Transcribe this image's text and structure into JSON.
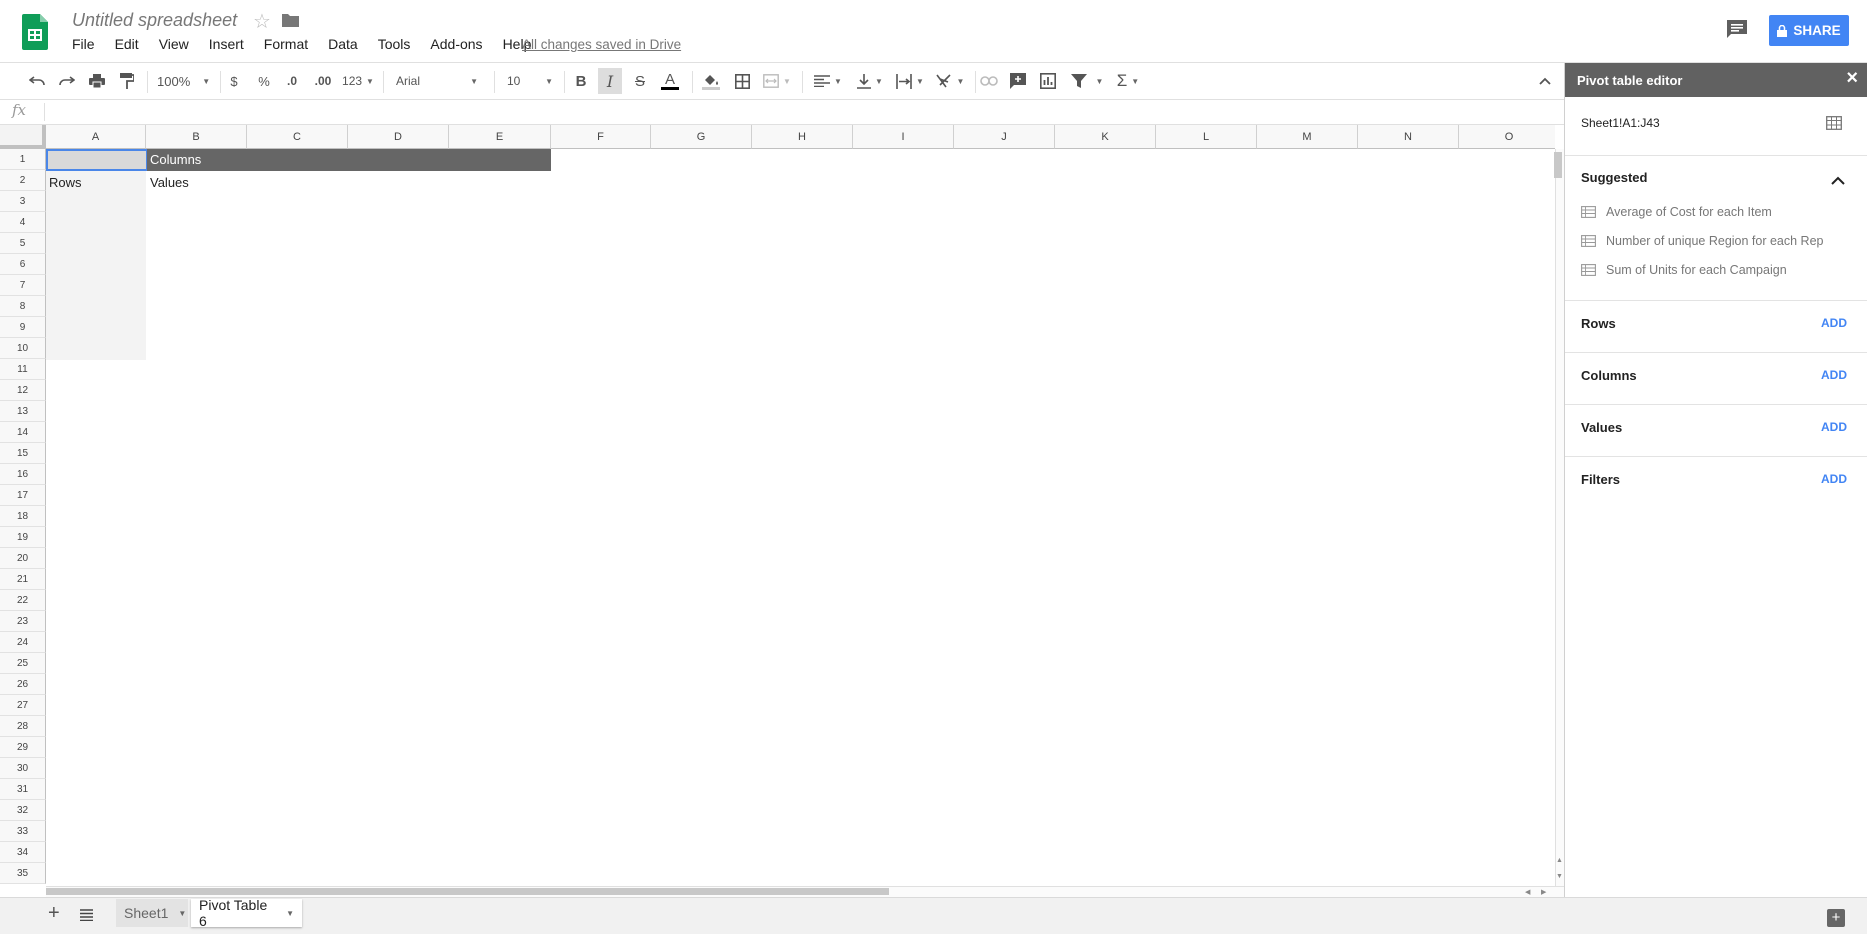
{
  "app": {
    "title": "Untitled spreadsheet",
    "save_status": "All changes saved in Drive",
    "share_label": "SHARE",
    "menu": [
      "File",
      "Edit",
      "View",
      "Insert",
      "Format",
      "Data",
      "Tools",
      "Add-ons",
      "Help"
    ]
  },
  "toolbar": {
    "zoom": "100%",
    "currency": "$",
    "percent": "%",
    "decrease_decimal": ".0",
    "increase_decimal": ".00",
    "more_formats": "123",
    "font": "Arial",
    "font_size": "10",
    "bold": "B",
    "italic": "I",
    "strike": "S",
    "text_color": "A",
    "sum": "Σ"
  },
  "formula_bar": {
    "fx": "fx",
    "value": ""
  },
  "grid": {
    "columns": [
      "A",
      "B",
      "C",
      "D",
      "E",
      "F",
      "G",
      "H",
      "I",
      "J",
      "K",
      "L",
      "M",
      "N",
      "O"
    ],
    "rows": [
      "1",
      "2",
      "3",
      "4",
      "5",
      "6",
      "7",
      "8",
      "9",
      "10",
      "11",
      "12",
      "13",
      "14",
      "15",
      "16",
      "17",
      "18",
      "19",
      "20",
      "21",
      "22",
      "23",
      "24",
      "25",
      "26",
      "27",
      "28",
      "29",
      "30",
      "31",
      "32",
      "33",
      "34",
      "35"
    ],
    "cells": {
      "B1": "Columns",
      "A2": "Rows",
      "B2": "Values"
    }
  },
  "sheets": [
    {
      "name": "Sheet1",
      "active": false
    },
    {
      "name": "Pivot Table 6",
      "active": true
    }
  ],
  "pivot_editor": {
    "title": "Pivot table editor",
    "range": "Sheet1!A1:J43",
    "suggested_title": "Suggested",
    "suggestions": [
      "Average of Cost for each Item",
      "Number of unique Region for each Rep",
      "Sum of Units for each Campaign"
    ],
    "sections": [
      {
        "title": "Rows",
        "action": "ADD"
      },
      {
        "title": "Columns",
        "action": "ADD"
      },
      {
        "title": "Values",
        "action": "ADD"
      },
      {
        "title": "Filters",
        "action": "ADD"
      }
    ]
  },
  "colors": {
    "brand_green": "#0f9d58",
    "share_blue": "#4285f4",
    "selection_blue": "#4a86e8",
    "panel_header": "#616161"
  }
}
